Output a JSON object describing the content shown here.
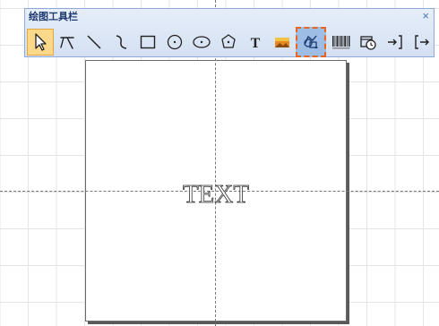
{
  "toolbar": {
    "title": "绘图工具栏",
    "close_glyph": "×",
    "tools": [
      {
        "name": "select-tool",
        "icon": "select-arrow-icon",
        "state": "selected"
      },
      {
        "name": "node-edit-tool",
        "icon": "node-edit-icon"
      },
      {
        "name": "line-tool",
        "icon": "line-icon"
      },
      {
        "name": "curve-tool",
        "icon": "curve-icon"
      },
      {
        "name": "rectangle-tool",
        "icon": "rectangle-icon"
      },
      {
        "name": "circle-tool",
        "icon": "circle-icon"
      },
      {
        "name": "ellipse-tool",
        "icon": "ellipse-icon"
      },
      {
        "name": "polygon-tool",
        "icon": "polygon-icon"
      },
      {
        "name": "text-tool",
        "icon": "text-t-icon",
        "glyph": "T"
      },
      {
        "name": "image-tool",
        "icon": "image-icon"
      },
      {
        "name": "vector-graphic-tool",
        "icon": "vector-graphic-icon",
        "state": "highlighted"
      },
      {
        "name": "barcode-tool",
        "icon": "barcode-icon"
      },
      {
        "name": "datetime-tool",
        "icon": "datetime-icon"
      },
      {
        "name": "import-tool",
        "icon": "import-icon"
      },
      {
        "name": "export-tool",
        "icon": "export-icon"
      }
    ]
  },
  "canvas": {
    "text": "TEXT"
  },
  "colors": {
    "toolbar_bg": "#dbe5f4",
    "toolbar_border": "#8da9d6",
    "selected_bg": "#fcd98a",
    "highlight_bg": "#9dbde4",
    "highlight_border": "#e8651f",
    "title_color": "#1f3a6e"
  }
}
